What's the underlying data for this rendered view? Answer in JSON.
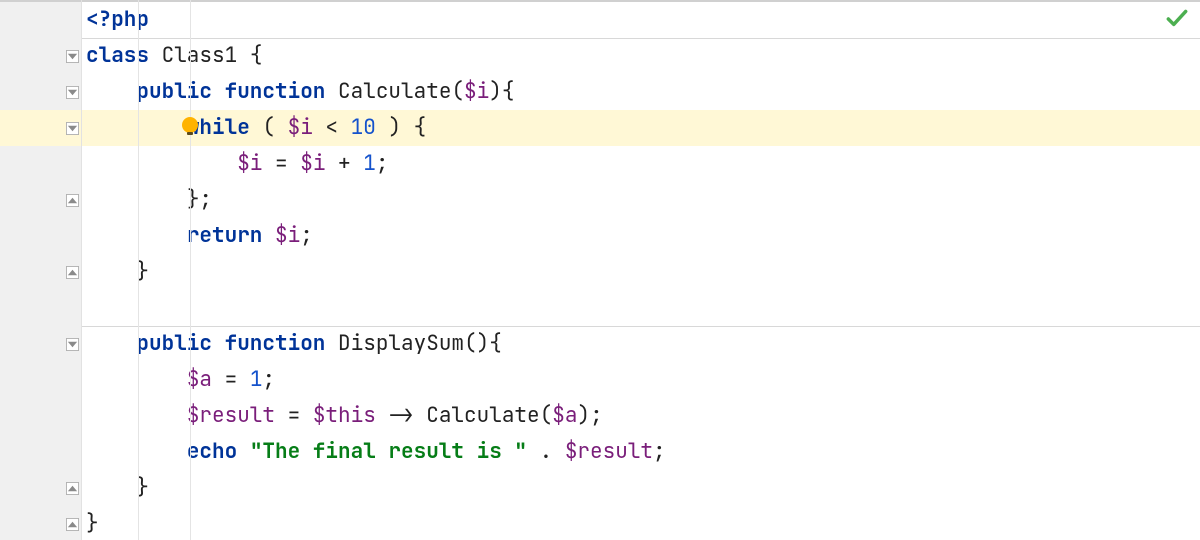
{
  "status": {
    "ok_icon_name": "checkmark-icon",
    "bulb_icon_name": "lightbulb-icon"
  },
  "colors": {
    "highlight_bg": "#fff8d6",
    "gutter_bg": "#f0f0f0",
    "keyword": "#003398",
    "number": "#1452cc",
    "string": "#067d17",
    "variable": "#7a1e7a"
  },
  "lines": [
    {
      "parts": [
        {
          "cls": "php",
          "t": "<?php"
        }
      ],
      "fold": null,
      "hl": false
    },
    {
      "parts": [
        {
          "cls": "kw",
          "t": "class "
        },
        {
          "cls": "cls",
          "t": "Class1 "
        },
        {
          "cls": "brace",
          "t": "{"
        }
      ],
      "fold": "open",
      "hl": false,
      "sep_above": true
    },
    {
      "parts": [
        {
          "cls": "",
          "t": "    "
        },
        {
          "cls": "kw",
          "t": "public function "
        },
        {
          "cls": "cls",
          "t": "Calculate"
        },
        {
          "cls": "brace",
          "t": "("
        },
        {
          "cls": "var",
          "t": "$i"
        },
        {
          "cls": "brace",
          "t": "){"
        }
      ],
      "fold": "open",
      "hl": false
    },
    {
      "parts": [
        {
          "cls": "",
          "t": "        "
        },
        {
          "cls": "kw",
          "t": "while "
        },
        {
          "cls": "brace",
          "t": "( "
        },
        {
          "cls": "var",
          "t": "$i"
        },
        {
          "cls": "op",
          "t": " < "
        },
        {
          "cls": "num",
          "t": "10"
        },
        {
          "cls": "brace",
          "t": " ) {"
        }
      ],
      "fold": "open",
      "hl": true
    },
    {
      "parts": [
        {
          "cls": "",
          "t": "            "
        },
        {
          "cls": "var",
          "t": "$i"
        },
        {
          "cls": "op",
          "t": " = "
        },
        {
          "cls": "var",
          "t": "$i"
        },
        {
          "cls": "op",
          "t": " + "
        },
        {
          "cls": "num",
          "t": "1"
        },
        {
          "cls": "op",
          "t": ";"
        }
      ],
      "fold": null,
      "hl": false
    },
    {
      "parts": [
        {
          "cls": "",
          "t": "        "
        },
        {
          "cls": "brace",
          "t": "};"
        }
      ],
      "fold": "close",
      "hl": false
    },
    {
      "parts": [
        {
          "cls": "",
          "t": "        "
        },
        {
          "cls": "kw",
          "t": "return "
        },
        {
          "cls": "var",
          "t": "$i"
        },
        {
          "cls": "op",
          "t": ";"
        }
      ],
      "fold": null,
      "hl": false
    },
    {
      "parts": [
        {
          "cls": "",
          "t": "    "
        },
        {
          "cls": "brace",
          "t": "}"
        }
      ],
      "fold": "close",
      "hl": false
    },
    {
      "parts": [
        {
          "cls": "",
          "t": " "
        }
      ],
      "fold": null,
      "hl": false,
      "sep_below": true
    },
    {
      "parts": [
        {
          "cls": "",
          "t": "    "
        },
        {
          "cls": "kw",
          "t": "public function "
        },
        {
          "cls": "cls",
          "t": "DisplaySum"
        },
        {
          "cls": "brace",
          "t": "(){"
        }
      ],
      "fold": "open",
      "hl": false
    },
    {
      "parts": [
        {
          "cls": "",
          "t": "        "
        },
        {
          "cls": "var",
          "t": "$a"
        },
        {
          "cls": "op",
          "t": " = "
        },
        {
          "cls": "num",
          "t": "1"
        },
        {
          "cls": "op",
          "t": ";"
        }
      ],
      "fold": null,
      "hl": false
    },
    {
      "parts": [
        {
          "cls": "",
          "t": "        "
        },
        {
          "cls": "var",
          "t": "$result"
        },
        {
          "cls": "op",
          "t": " = "
        },
        {
          "cls": "var",
          "t": "$this"
        },
        {
          "cls": "op",
          "t": " -> "
        },
        {
          "cls": "cls",
          "t": "Calculate"
        },
        {
          "cls": "brace",
          "t": "("
        },
        {
          "cls": "var",
          "t": "$a"
        },
        {
          "cls": "brace",
          "t": ")"
        },
        {
          "cls": "op",
          "t": ";"
        }
      ],
      "fold": null,
      "hl": false
    },
    {
      "parts": [
        {
          "cls": "",
          "t": "        "
        },
        {
          "cls": "kw",
          "t": "echo "
        },
        {
          "cls": "str",
          "t": "\"The final result is \""
        },
        {
          "cls": "op",
          "t": " . "
        },
        {
          "cls": "var",
          "t": "$result"
        },
        {
          "cls": "op",
          "t": ";"
        }
      ],
      "fold": null,
      "hl": false
    },
    {
      "parts": [
        {
          "cls": "",
          "t": "    "
        },
        {
          "cls": "brace",
          "t": "}"
        }
      ],
      "fold": "close",
      "hl": false
    },
    {
      "parts": [
        {
          "cls": "brace",
          "t": "}"
        }
      ],
      "fold": "close",
      "hl": false
    }
  ]
}
